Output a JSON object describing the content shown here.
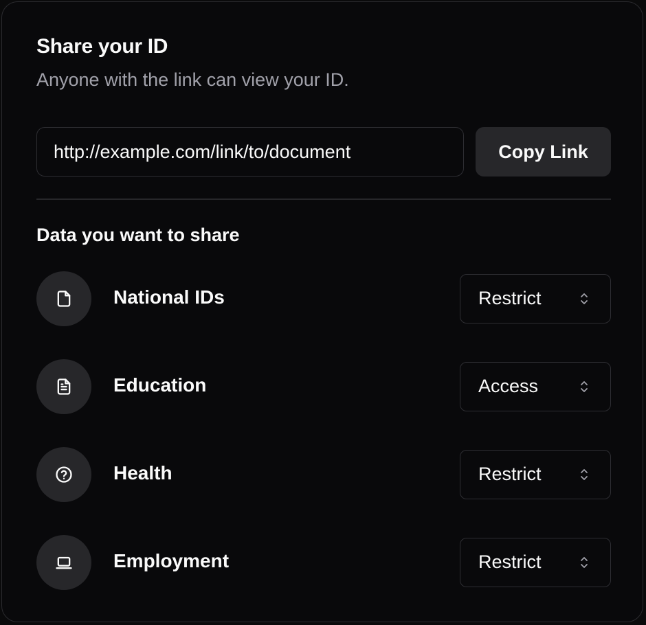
{
  "card": {
    "title": "Share your ID",
    "subtitle": "Anyone with the link can view your ID."
  },
  "share_link": {
    "value": "http://example.com/link/to/document",
    "copy_label": "Copy Link"
  },
  "data_section": {
    "title": "Data you want to share",
    "items": [
      {
        "label": "National IDs",
        "icon": "file-icon",
        "permission": "Restrict"
      },
      {
        "label": "Education",
        "icon": "file-text-icon",
        "permission": "Access"
      },
      {
        "label": "Health",
        "icon": "help-circle-icon",
        "permission": "Restrict"
      },
      {
        "label": "Employment",
        "icon": "laptop-icon",
        "permission": "Restrict"
      }
    ]
  },
  "colors": {
    "background": "#09090b",
    "border": "#27272a",
    "text": "#fafafa",
    "muted_text": "#a1a1aa",
    "button_bg": "#27272a"
  }
}
